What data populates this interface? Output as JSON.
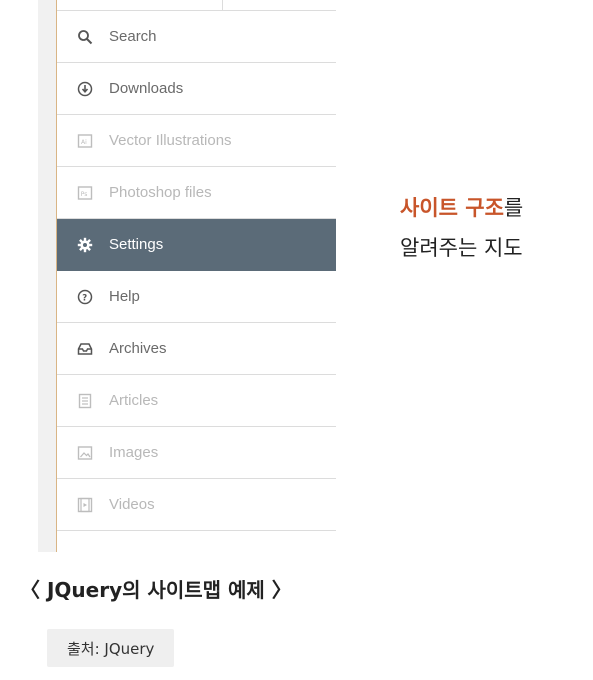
{
  "sidebar": {
    "items": [
      {
        "label": "Search",
        "icon": "search-icon",
        "state": "normal"
      },
      {
        "label": "Downloads",
        "icon": "download-icon",
        "state": "normal"
      },
      {
        "label": "Vector Illustrations",
        "icon": "ai-file-icon",
        "state": "muted"
      },
      {
        "label": "Photoshop files",
        "icon": "ps-file-icon",
        "state": "muted"
      },
      {
        "label": "Settings",
        "icon": "gear-icon",
        "state": "active"
      },
      {
        "label": "Help",
        "icon": "help-icon",
        "state": "normal"
      },
      {
        "label": "Archives",
        "icon": "inbox-icon",
        "state": "normal"
      },
      {
        "label": "Articles",
        "icon": "article-icon",
        "state": "muted"
      },
      {
        "label": "Images",
        "icon": "image-icon",
        "state": "muted"
      },
      {
        "label": "Videos",
        "icon": "video-icon",
        "state": "muted"
      }
    ]
  },
  "caption_right": {
    "highlight": "사이트 구조",
    "suffix": "를",
    "line2": "알려주는 지도"
  },
  "figure_caption": "〈 JQuery의 사이트맵 예제 〉",
  "source": "출처: JQuery",
  "colors": {
    "active_bg": "#5b6b78",
    "highlight": "#c8552a",
    "text": "#6a6a6a",
    "muted_text": "#b8b8b8",
    "sidebar_border": "#d9b585"
  }
}
